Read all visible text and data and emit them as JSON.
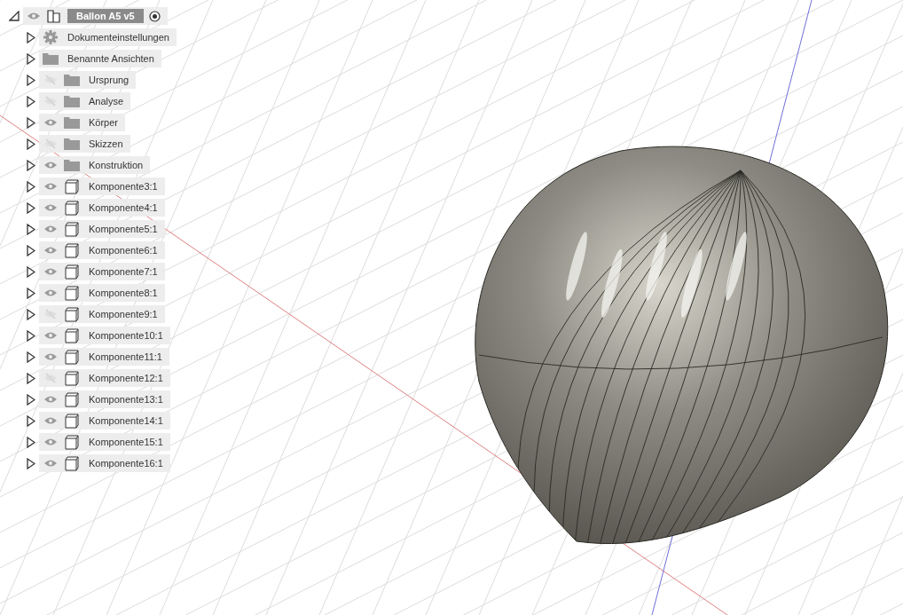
{
  "browser": {
    "root": {
      "label": "Ballon A5 v5",
      "expanded": true,
      "selected": true,
      "visible": true
    },
    "items": [
      {
        "kind": "settings",
        "label": "Dokumenteinstellungen"
      },
      {
        "kind": "folder",
        "label": "Benannte Ansichten"
      },
      {
        "kind": "folder",
        "label": "Ursprung",
        "visible": false
      },
      {
        "kind": "folder",
        "label": "Analyse",
        "visible": false
      },
      {
        "kind": "folder",
        "label": "Körper",
        "visible": true
      },
      {
        "kind": "folder",
        "label": "Skizzen",
        "visible": false
      },
      {
        "kind": "folder",
        "label": "Konstruktion",
        "visible": true
      },
      {
        "kind": "component",
        "label": "Komponente3:1",
        "visible": true
      },
      {
        "kind": "component",
        "label": "Komponente4:1",
        "visible": true
      },
      {
        "kind": "component",
        "label": "Komponente5:1",
        "visible": true
      },
      {
        "kind": "component",
        "label": "Komponente6:1",
        "visible": true
      },
      {
        "kind": "component",
        "label": "Komponente7:1",
        "visible": true
      },
      {
        "kind": "component",
        "label": "Komponente8:1",
        "visible": true
      },
      {
        "kind": "component",
        "label": "Komponente9:1",
        "visible": false
      },
      {
        "kind": "component",
        "label": "Komponente10:1",
        "visible": true
      },
      {
        "kind": "component",
        "label": "Komponente11:1",
        "visible": true
      },
      {
        "kind": "component",
        "label": "Komponente12:1",
        "visible": false
      },
      {
        "kind": "component",
        "label": "Komponente13:1",
        "visible": true
      },
      {
        "kind": "component",
        "label": "Komponente14:1",
        "visible": true
      },
      {
        "kind": "component",
        "label": "Komponente15:1",
        "visible": true
      },
      {
        "kind": "component",
        "label": "Komponente16:1",
        "visible": true
      }
    ]
  }
}
